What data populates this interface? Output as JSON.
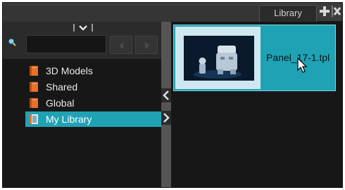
{
  "header": {
    "tab_label": "Library",
    "add_icon": "plus-icon",
    "close_icon": "close-icon"
  },
  "toolbar": {
    "collapse_icon": "chevron-down-icon",
    "search_icon": "search-icon",
    "search_value": "",
    "prev_icon": "arrow-left-icon",
    "next_icon": "arrow-right-icon"
  },
  "tree": {
    "items": [
      {
        "label": "3D Models",
        "icon": "book-icon",
        "selected": false
      },
      {
        "label": "Shared",
        "icon": "book-icon",
        "selected": false
      },
      {
        "label": "Global",
        "icon": "book-icon",
        "selected": false
      },
      {
        "label": "My Library",
        "icon": "book-icon",
        "selected": true
      }
    ]
  },
  "splitter": {
    "collapse_icon": "chevron-left-icon",
    "expand_icon": "chevron-right-icon"
  },
  "content": {
    "items": [
      {
        "name": "Panel_17-1.tpl",
        "thumbnail": "character-thumbnail",
        "selected": true
      }
    ]
  },
  "colors": {
    "selection": "#20a2b5",
    "panel_bg": "#171717",
    "frame_bg": "#2b2b2b",
    "book_orange": "#e8702a"
  }
}
